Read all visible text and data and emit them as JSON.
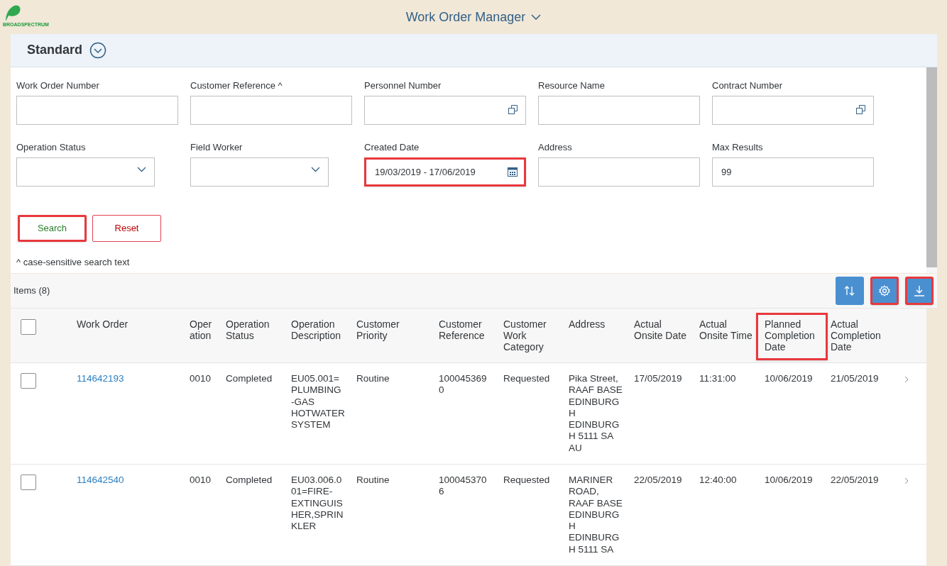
{
  "header": {
    "logo_text": "BROADSPECTRUM",
    "title": "Work Order Manager"
  },
  "variant": {
    "title": "Standard"
  },
  "filters": [
    {
      "label": "Work Order Number",
      "kind": "text",
      "highlighted": false
    },
    {
      "label": "Customer Reference ^",
      "kind": "text",
      "highlighted": false
    },
    {
      "label": "Personnel Number",
      "kind": "valuehelp",
      "highlighted": false
    },
    {
      "label": "Resource Name",
      "kind": "text",
      "highlighted": false
    },
    {
      "label": "Contract Number",
      "kind": "valuehelp",
      "highlighted": false
    },
    {
      "label": "Operation Status",
      "kind": "select",
      "highlighted": false
    },
    {
      "label": "Field Worker",
      "kind": "select",
      "highlighted": false
    },
    {
      "label": "Created Date",
      "kind": "date",
      "value": "19/03/2019 - 17/06/2019",
      "highlighted": true
    },
    {
      "label": "Address",
      "kind": "text",
      "highlighted": false
    },
    {
      "label": "Max Results",
      "kind": "text",
      "value": "99",
      "highlighted": false
    }
  ],
  "buttons": [
    {
      "label": "Search",
      "kind": "search",
      "highlighted": true
    },
    {
      "label": "Reset",
      "kind": "reset",
      "highlighted": false
    }
  ],
  "note": "^ case-sensitive search text",
  "table": {
    "count_label": "Items (8)",
    "select_all_checked": false,
    "toolbar": [
      {
        "kind": "sort",
        "highlighted": false
      },
      {
        "kind": "settings",
        "highlighted": true
      },
      {
        "kind": "download",
        "highlighted": true
      }
    ],
    "columns": [
      {
        "label": "Work Order",
        "highlighted": false
      },
      {
        "label": "Oper ation",
        "highlighted": false
      },
      {
        "label": "Operation Status",
        "highlighted": false
      },
      {
        "label": "Operation Description",
        "highlighted": false
      },
      {
        "label": "Customer Priority",
        "highlighted": false
      },
      {
        "label": "Customer Reference",
        "highlighted": false
      },
      {
        "label": "Customer Work Category",
        "highlighted": false
      },
      {
        "label": "Address",
        "highlighted": false
      },
      {
        "label": "Actual Onsite Date",
        "highlighted": false
      },
      {
        "label": "Actual Onsite Time",
        "highlighted": false
      },
      {
        "label": "Planned Completion Date",
        "highlighted": true
      },
      {
        "label": "Actual Completion Date",
        "highlighted": false
      }
    ],
    "rows": [
      {
        "checked": false,
        "cells": [
          "114642193",
          "0010",
          "Completed",
          "EU05.001= PLUMBING -GAS HOTWATER SYSTEM",
          "Routine",
          "1000453690",
          "Requested",
          "Pika Street, RAAF BASE EDINBURGH EDINBURGH 5111 SA AU",
          "17/05/2019",
          "11:31:00",
          "10/06/2019",
          "21/05/2019"
        ]
      },
      {
        "checked": false,
        "cells": [
          "114642540",
          "0010",
          "Completed",
          "EU03.006.001=FIRE-EXTINGUISHER,SPRINKLER",
          "Routine",
          "1000453706",
          "Requested",
          "MARINER ROAD, RAAF BASE EDINBURGH EDINBURGH 5111 SA",
          "22/05/2019",
          "12:40:00",
          "10/06/2019",
          "22/05/2019"
        ]
      }
    ]
  }
}
